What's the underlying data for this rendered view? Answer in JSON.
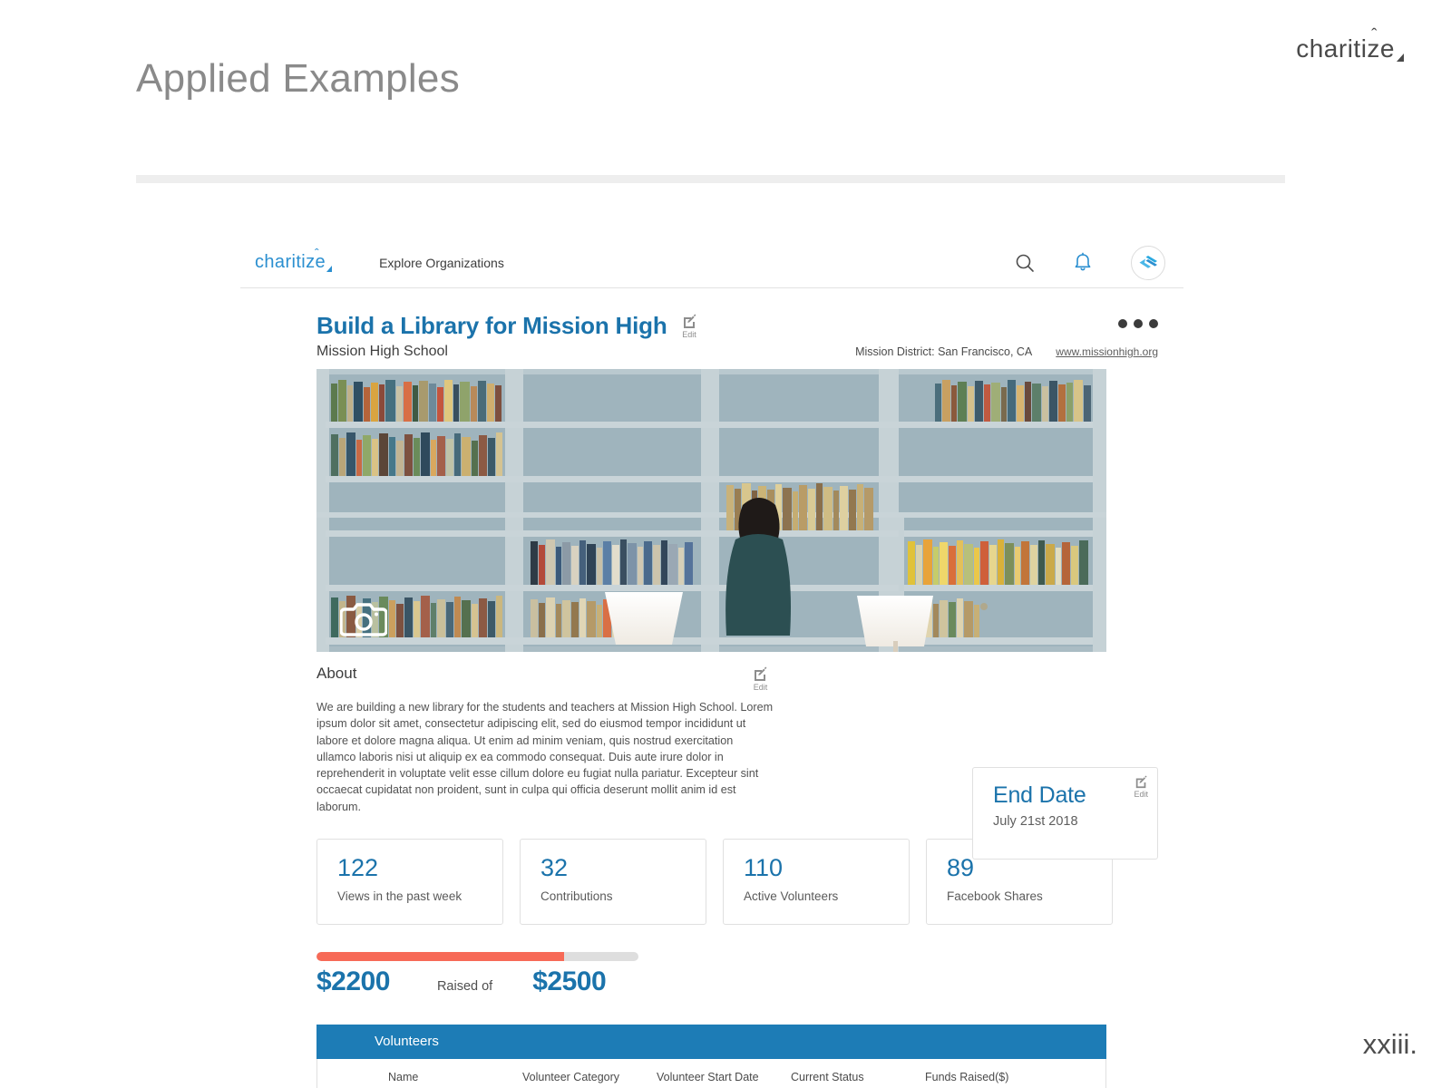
{
  "slide": {
    "title": "Applied Examples",
    "page_number": "xxiii.",
    "brand": "charitize"
  },
  "app": {
    "nav": {
      "logo": "charitize",
      "link": "Explore Organizations",
      "icons": [
        "search-icon",
        "bell-icon",
        "avatar"
      ]
    },
    "campaign": {
      "title": "Build a Library for Mission High",
      "edit_label": "Edit",
      "org_name": "Mission High School",
      "district_label": "Mission District:",
      "location": "San Francisco, CA",
      "website": "www.missionhigh.org"
    },
    "about": {
      "heading": "About",
      "edit_label": "Edit",
      "body": "We are building a new library for the students and teachers at Mission High School.  Lorem ipsum dolor sit amet, consectetur adipiscing elit, sed do eiusmod tempor incididunt ut labore et dolore magna aliqua. Ut enim ad minim veniam, quis nostrud exercitation ullamco laboris nisi ut aliquip ex ea commodo consequat. Duis aute irure dolor in reprehenderit in voluptate velit esse cillum dolore eu fugiat nulla pariatur. Excepteur sint occaecat cupidatat non proident, sunt in culpa qui officia deserunt mollit anim id est laborum."
    },
    "end_date": {
      "title": "End Date",
      "value": "July 21st 2018",
      "edit_label": "Edit"
    },
    "stats": [
      {
        "value": "122",
        "label": "Views in the past week"
      },
      {
        "value": "32",
        "label": "Contributions"
      },
      {
        "value": "110",
        "label": "Active Volunteers"
      },
      {
        "value": "89",
        "label": "Facebook Shares"
      }
    ],
    "fundraising": {
      "raised": "$2200",
      "middle_label": "Raised of",
      "goal": "$2500",
      "percent": 77
    },
    "volunteers_table": {
      "header": "Volunteers",
      "columns": [
        "Name",
        "Volunteer Category",
        "Volunteer Start Date",
        "Current Status",
        "Funds Raised($)"
      ]
    }
  },
  "colors": {
    "brand_blue": "#1b73ab",
    "nav_blue": "#2b8fd0",
    "table_blue": "#1d7cb6",
    "progress_coral": "#f76a57",
    "title_gray": "#8a8a8a"
  }
}
